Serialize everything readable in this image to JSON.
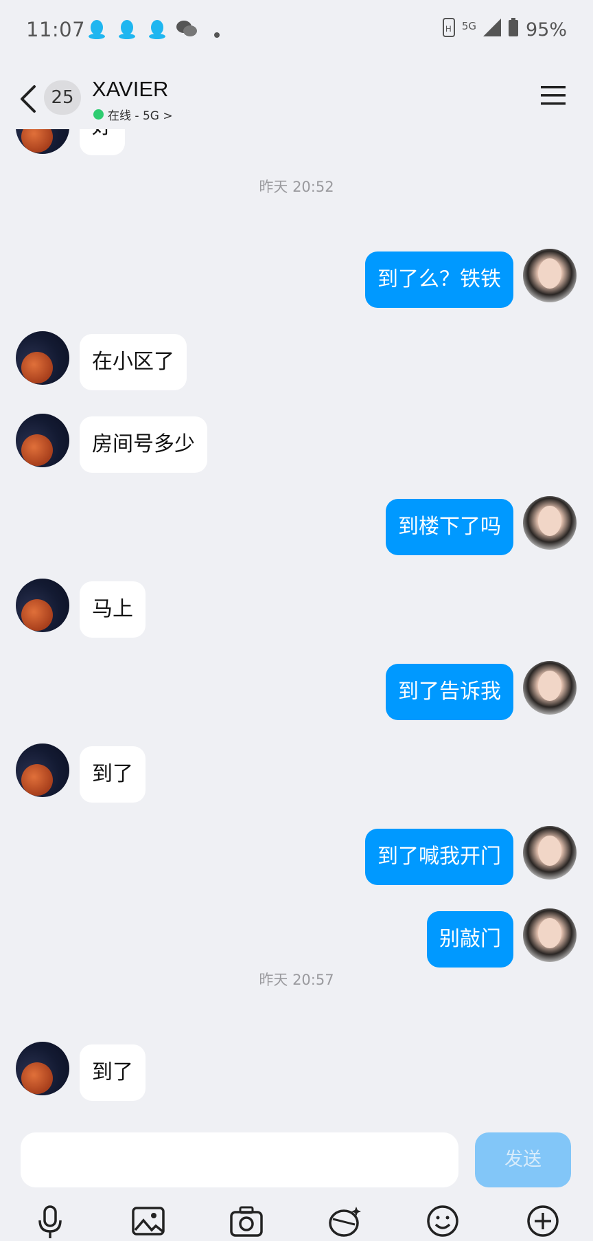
{
  "status_bar": {
    "time": "11:07",
    "network": "5G",
    "battery": "95%",
    "notification_icons": [
      "qq-icon",
      "qq-icon",
      "qq-icon",
      "wechat-icon"
    ]
  },
  "header": {
    "unread_count": "25",
    "contact_name": "XAVIER",
    "status": "在线 - 5G >"
  },
  "messages": [
    {
      "side": "in",
      "text": "好"
    },
    {
      "type": "timestamp",
      "text": "昨天 20:52"
    },
    {
      "side": "out",
      "text": "到了么？铁铁"
    },
    {
      "side": "in",
      "text": "在小区了"
    },
    {
      "side": "in",
      "text": "房间号多少"
    },
    {
      "side": "out",
      "text": "到楼下了吗"
    },
    {
      "side": "in",
      "text": "马上"
    },
    {
      "side": "out",
      "text": "到了告诉我"
    },
    {
      "side": "in",
      "text": "到了"
    },
    {
      "side": "out",
      "text": "到了喊我开门"
    },
    {
      "side": "out",
      "text": "别敲门"
    },
    {
      "type": "timestamp",
      "text": "昨天 20:57"
    },
    {
      "side": "in",
      "text": "到了"
    }
  ],
  "composer": {
    "placeholder": "",
    "send_label": "发送"
  },
  "toolbar": [
    "mic-icon",
    "image-icon",
    "camera-icon",
    "red-packet-icon",
    "emoji-icon",
    "plus-icon"
  ],
  "colors": {
    "accent": "#0099ff",
    "background": "#eff0f4",
    "online": "#2ecc71"
  }
}
